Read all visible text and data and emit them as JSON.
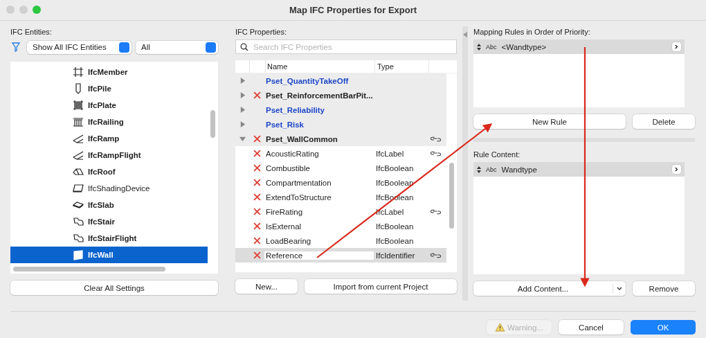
{
  "window": {
    "title": "Map IFC Properties for Export"
  },
  "entities": {
    "label": "IFC Entities:",
    "filter": "Show All IFC Entities",
    "scope": "All",
    "items": [
      {
        "name": "IfcMember",
        "kind": "member",
        "bold": true,
        "selected": false
      },
      {
        "name": "IfcPile",
        "kind": "pile",
        "bold": true,
        "selected": false
      },
      {
        "name": "IfcPlate",
        "kind": "plate",
        "bold": true,
        "selected": false
      },
      {
        "name": "IfcRailing",
        "kind": "railing",
        "bold": true,
        "selected": false
      },
      {
        "name": "IfcRamp",
        "kind": "ramp",
        "bold": true,
        "selected": false
      },
      {
        "name": "IfcRampFlight",
        "kind": "ramp",
        "bold": true,
        "selected": false
      },
      {
        "name": "IfcRoof",
        "kind": "roof",
        "bold": true,
        "selected": false
      },
      {
        "name": "IfcShadingDevice",
        "kind": "shading",
        "bold": false,
        "selected": false
      },
      {
        "name": "IfcSlab",
        "kind": "slab",
        "bold": true,
        "selected": false
      },
      {
        "name": "IfcStair",
        "kind": "stair",
        "bold": true,
        "selected": false
      },
      {
        "name": "IfcStairFlight",
        "kind": "stair",
        "bold": true,
        "selected": false
      },
      {
        "name": "IfcWall",
        "kind": "wall",
        "bold": true,
        "selected": true
      }
    ],
    "clear_button": "Clear All Settings"
  },
  "properties": {
    "label": "IFC Properties:",
    "search": {
      "placeholder": "Search IFC Properties"
    },
    "columns": [
      "Name",
      "Type"
    ],
    "rows": [
      {
        "kind": "group",
        "name": "Pset_QuantityTakeOff",
        "expanded": false,
        "mapped": false,
        "linked": false,
        "selected": false
      },
      {
        "kind": "group",
        "name": "Pset_ReinforcementBarPit...",
        "expanded": false,
        "mapped": true,
        "linked": false,
        "selected": false
      },
      {
        "kind": "group",
        "name": "Pset_Reliability",
        "expanded": false,
        "mapped": false,
        "linked": false,
        "selected": false
      },
      {
        "kind": "group",
        "name": "Pset_Risk",
        "expanded": false,
        "mapped": false,
        "linked": false,
        "selected": false
      },
      {
        "kind": "group",
        "name": "Pset_WallCommon",
        "expanded": true,
        "mapped": true,
        "linked": true,
        "selected": false
      },
      {
        "kind": "property",
        "name": "AcousticRating",
        "type": "IfcLabel",
        "mapped": true,
        "linked": true,
        "selected": false
      },
      {
        "kind": "property",
        "name": "Combustible",
        "type": "IfcBoolean",
        "mapped": true,
        "linked": false,
        "selected": false
      },
      {
        "kind": "property",
        "name": "Compartmentation",
        "type": "IfcBoolean",
        "mapped": true,
        "linked": false,
        "selected": false
      },
      {
        "kind": "property",
        "name": "ExtendToStructure",
        "type": "IfcBoolean",
        "mapped": true,
        "linked": false,
        "selected": false
      },
      {
        "kind": "property",
        "name": "FireRating",
        "type": "IfcLabel",
        "mapped": true,
        "linked": true,
        "selected": false
      },
      {
        "kind": "property",
        "name": "IsExternal",
        "type": "IfcBoolean",
        "mapped": true,
        "linked": false,
        "selected": false
      },
      {
        "kind": "property",
        "name": "LoadBearing",
        "type": "IfcBoolean",
        "mapped": true,
        "linked": false,
        "selected": false
      },
      {
        "kind": "property",
        "name": "Reference",
        "type": "IfcIdentifier",
        "mapped": true,
        "linked": true,
        "selected": true
      }
    ],
    "buttons": [
      "New...",
      "Import from current Project"
    ]
  },
  "rules": {
    "label": "Mapping Rules in Order of Priority:",
    "items": [
      {
        "tag": "Abc",
        "name": "<Wandtype>"
      }
    ],
    "buttons": [
      "New Rule",
      "Delete"
    ]
  },
  "content": {
    "label": "Rule Content:",
    "items": [
      {
        "tag": "Abc",
        "name": "Wandtype"
      }
    ],
    "add_button": "Add Content...",
    "remove_button": "Remove"
  },
  "footer": {
    "warning": "Warning...",
    "warning_disabled": true,
    "cancel": "Cancel",
    "ok": "OK"
  }
}
